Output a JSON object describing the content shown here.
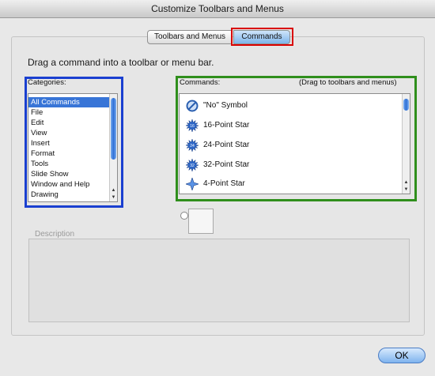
{
  "window": {
    "title": "Customize Toolbars and Menus"
  },
  "tabs": [
    {
      "label": "Toolbars and Menus",
      "selected": false
    },
    {
      "label": "Commands",
      "selected": true
    }
  ],
  "instruction": "Drag a command into a toolbar or menu bar.",
  "categories": {
    "label": "Categories:",
    "items": [
      "All Commands",
      "File",
      "Edit",
      "View",
      "Insert",
      "Format",
      "Tools",
      "Slide Show",
      "Window and Help",
      "Drawing"
    ],
    "selected": "All Commands"
  },
  "commands": {
    "label": "Commands:",
    "hint": "(Drag to toolbars and menus)",
    "items": [
      {
        "label": "\"No\" Symbol",
        "icon": "no-symbol-icon"
      },
      {
        "label": "16-Point Star",
        "icon": "star-16-icon"
      },
      {
        "label": "24-Point Star",
        "icon": "star-24-icon"
      },
      {
        "label": "32-Point Star",
        "icon": "star-32-icon"
      },
      {
        "label": "4-Point Star",
        "icon": "star-4-icon"
      }
    ]
  },
  "description": {
    "label": "Description"
  },
  "buttons": {
    "ok": "OK"
  },
  "colors": {
    "highlight_red": "#d90000",
    "highlight_blue": "#1a3fd0",
    "highlight_green": "#2f8f1c",
    "selection": "#3875d7"
  }
}
